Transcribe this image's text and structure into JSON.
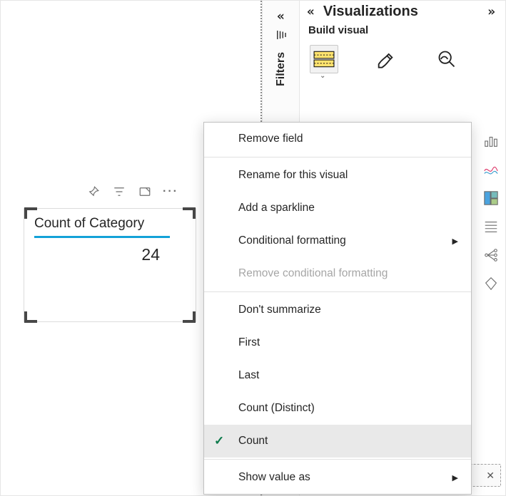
{
  "card": {
    "title": "Count of Category",
    "value": "24"
  },
  "toolbar": {
    "pin": "Pin",
    "filter": "Filter",
    "focus": "Focus mode",
    "more": "More options"
  },
  "filtersPane": {
    "label": "Filters"
  },
  "vizPane": {
    "title": "Visualizations",
    "subtitle": "Build visual",
    "tabs": {
      "build": "Build",
      "format": "Format",
      "analytics": "Analytics"
    }
  },
  "menu": {
    "remove_field": "Remove field",
    "rename": "Rename for this visual",
    "sparkline": "Add a sparkline",
    "cond_fmt": "Conditional formatting",
    "remove_cond": "Remove conditional formatting",
    "dont_sum": "Don't summarize",
    "first": "First",
    "last": "Last",
    "count_distinct": "Count (Distinct)",
    "count": "Count",
    "show_value_as": "Show value as"
  },
  "icons": {
    "shield": "shield"
  }
}
